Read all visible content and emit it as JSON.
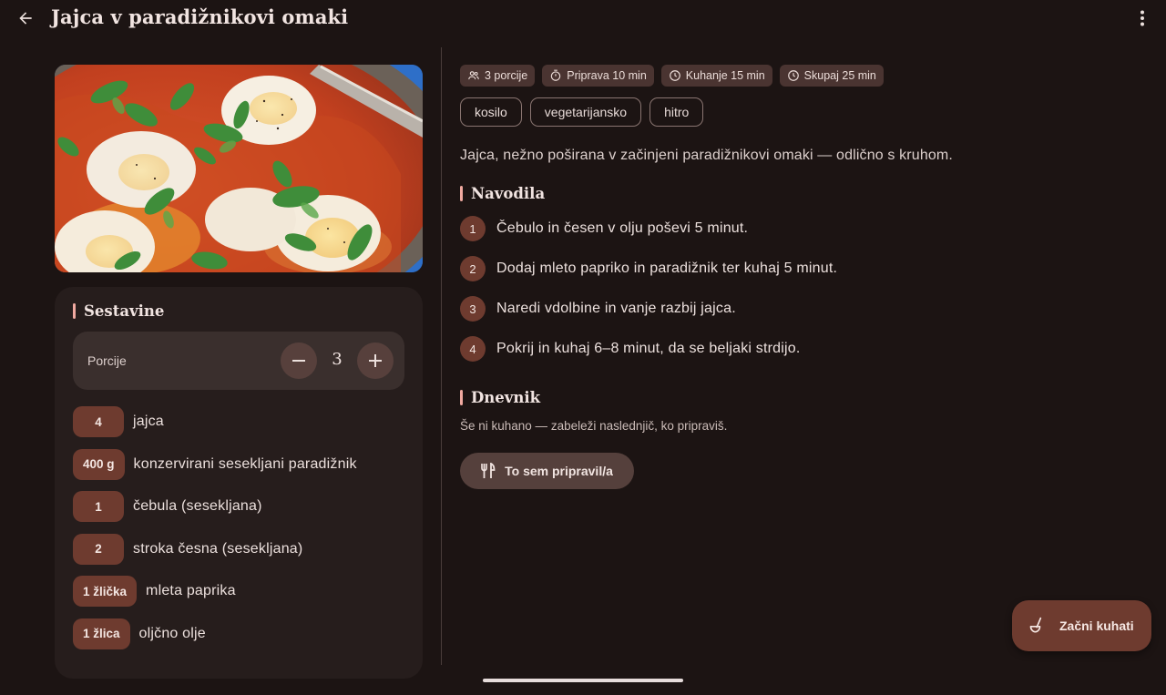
{
  "colors": {
    "background": "#1c1413",
    "accent": "#6e3b2f",
    "section_bar": "#f0a9a0",
    "card": "#261d1c",
    "chip": "#4a3431"
  },
  "topbar": {
    "title": "Jajca v paradižnikovi omaki",
    "back_icon": "arrow-left-icon",
    "menu_icon": "more-vertical-icon"
  },
  "ingredients": {
    "title": "Sestavine",
    "servings_label": "Porcije",
    "servings_value": "3",
    "items": [
      {
        "qty": "4",
        "name": "jajca"
      },
      {
        "qty": "400 g",
        "name": "konzervirani sesekljani paradižnik"
      },
      {
        "qty": "1",
        "name": "čebula (sesekljana)"
      },
      {
        "qty": "2",
        "name": "stroka česna (sesekljana)"
      },
      {
        "qty": "1 žlička",
        "name": "mleta paprika"
      },
      {
        "qty": "1 žlica",
        "name": "oljčno olje"
      }
    ]
  },
  "chips": [
    {
      "icon": "people-icon",
      "label": "3 porcije"
    },
    {
      "icon": "timer-icon",
      "label": "Priprava 10 min"
    },
    {
      "icon": "clock-icon",
      "label": "Kuhanje 15 min"
    },
    {
      "icon": "clock-icon",
      "label": "Skupaj 25 min"
    }
  ],
  "tags": [
    "kosilo",
    "vegetarijansko",
    "hitro"
  ],
  "description": "Jajca, nežno poširana v začinjeni paradižnikovi omaki — odlično s kruhom.",
  "instructions": {
    "title": "Navodila",
    "steps": [
      {
        "num": "1",
        "text": "Čebulo in česen v olju poševi 5 minut."
      },
      {
        "num": "2",
        "text": "Dodaj mleto papriko in paradižnik ter kuhaj 5 minut."
      },
      {
        "num": "3",
        "text": "Naredi vdolbine in vanje razbij jajca."
      },
      {
        "num": "4",
        "text": "Pokrij in kuhaj 6–8 minut, da se beljaki strdijo."
      }
    ]
  },
  "log": {
    "title": "Dnevnik",
    "empty_text": "Še ni kuhano — zabeleži naslednjič, ko pripraviš.",
    "button_label": "To sem pripravil/a"
  },
  "fab": {
    "label": "Začni kuhati",
    "icon": "ladle-icon"
  }
}
